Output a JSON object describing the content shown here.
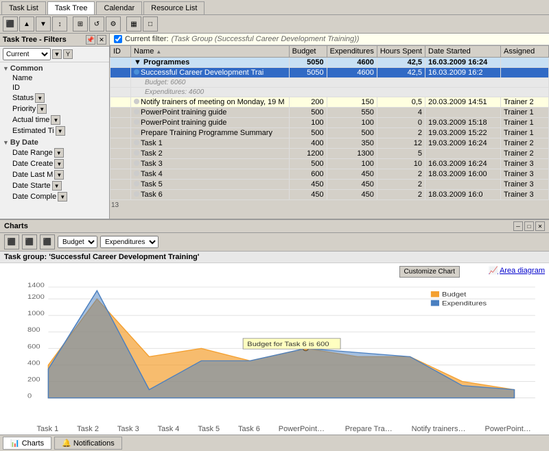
{
  "tabs": {
    "items": [
      "Task List",
      "Task Tree",
      "Calendar",
      "Resource List"
    ],
    "active": "Task Tree"
  },
  "toolbar": {
    "buttons": [
      "⬛",
      "↑",
      "↓",
      "↕",
      "⊞",
      "↺",
      "⚙",
      "▦",
      "□"
    ]
  },
  "left_panel": {
    "title": "Task Tree - Filters",
    "filter_label": "Current",
    "sections": {
      "common": {
        "label": "Common",
        "items": [
          "Name",
          "ID",
          "Status",
          "Priority",
          "Actual time",
          "Estimated Ti"
        ]
      },
      "by_date": {
        "label": "By Date",
        "items": [
          "Date Range",
          "Date Create",
          "Date Last M",
          "Date Starte",
          "Date Comple"
        ]
      }
    }
  },
  "filter_bar": {
    "checkbox_checked": true,
    "label": "Current filter:",
    "value": "(Task Group (Successful Career Development Training))"
  },
  "table": {
    "columns": [
      "ID",
      "Name",
      "Budget",
      "Expenditures",
      "Hours Spent",
      "Date Started",
      "Assigned"
    ],
    "rows": [
      {
        "id": "",
        "name": "Programmes",
        "budget": "5050",
        "expenditures": "4600",
        "hours": "42,5",
        "date": "16.03.2009 16:24",
        "assigned": "",
        "type": "group-top"
      },
      {
        "id": "",
        "name": "Successful Career Development Trai",
        "budget": "5050",
        "expenditures": "4600",
        "hours": "42,5",
        "date": "16.03.2009 16:2",
        "assigned": "",
        "type": "selected"
      },
      {
        "id": "",
        "name": "Budget: 6060",
        "budget": "",
        "expenditures": "",
        "hours": "",
        "date": "",
        "assigned": "",
        "type": "budget-row"
      },
      {
        "id": "",
        "name": "Expenditures: 4600",
        "budget": "",
        "expenditures": "",
        "hours": "",
        "date": "",
        "assigned": "",
        "type": "budget-row"
      },
      {
        "id": "",
        "name": "Notify trainers of meeting on Monday, 19 M",
        "budget": "200",
        "expenditures": "150",
        "hours": "0,5",
        "date": "20.03.2009 14:51",
        "assigned": "Trainer 2",
        "type": "notify"
      },
      {
        "id": "",
        "name": "PowerPoint training guide",
        "budget": "500",
        "expenditures": "550",
        "hours": "4",
        "date": "",
        "assigned": "Trainer 1",
        "type": "normal"
      },
      {
        "id": "",
        "name": "PowerPoint training guide",
        "budget": "100",
        "expenditures": "100",
        "hours": "0",
        "date": "19.03.2009 15:18",
        "assigned": "Trainer 1",
        "type": "normal"
      },
      {
        "id": "",
        "name": "Prepare Training Programme Summary",
        "budget": "500",
        "expenditures": "500",
        "hours": "2",
        "date": "19.03.2009 15:22",
        "assigned": "Trainer 1",
        "type": "normal"
      },
      {
        "id": "",
        "name": "Task 1",
        "budget": "400",
        "expenditures": "350",
        "hours": "12",
        "date": "19.03.2009 16:24",
        "assigned": "Trainer 2",
        "type": "normal"
      },
      {
        "id": "",
        "name": "Task 2",
        "budget": "1200",
        "expenditures": "1300",
        "hours": "5",
        "date": "",
        "assigned": "Trainer 2",
        "type": "normal"
      },
      {
        "id": "",
        "name": "Task 3",
        "budget": "500",
        "expenditures": "100",
        "hours": "10",
        "date": "16.03.2009 16:24",
        "assigned": "Trainer 3",
        "type": "normal"
      },
      {
        "id": "",
        "name": "Task 4",
        "budget": "600",
        "expenditures": "450",
        "hours": "2",
        "date": "18.03.2009 16:00",
        "assigned": "Trainer 3",
        "type": "normal"
      },
      {
        "id": "",
        "name": "Task 5",
        "budget": "450",
        "expenditures": "450",
        "hours": "2",
        "date": "",
        "assigned": "Trainer 3",
        "type": "normal"
      },
      {
        "id": "",
        "name": "Task 6",
        "budget": "450",
        "expenditures": "450",
        "hours": "2",
        "date": "18.03.2009 16:0",
        "assigned": "Trainer 3",
        "type": "normal"
      }
    ],
    "row_count": "13"
  },
  "charts": {
    "title": "Charts",
    "group_label": "Task group: 'Successful Career Development Training'",
    "series1": "Budget",
    "series2": "Expenditures",
    "customize_btn": "Customize Chart",
    "area_diagram_label": "Area diagram",
    "tooltip": "Budget for Task 6 is 600",
    "x_labels": [
      "Task 1",
      "Task 2",
      "Task 3",
      "Task 4",
      "Task 5",
      "Task 6",
      "PowerPoint training guide",
      "Prepare Training Programme...",
      "Notify trainers of meeting on...",
      "PowerPoint training guide"
    ],
    "budget_values": [
      400,
      1200,
      500,
      600,
      450,
      600,
      500,
      500,
      200,
      100
    ],
    "expenditures_values": [
      350,
      1300,
      100,
      450,
      450,
      600,
      550,
      500,
      150,
      100
    ],
    "y_axis": [
      0,
      200,
      400,
      600,
      800,
      1000,
      1200,
      1400
    ],
    "legend": {
      "budget_color": "#f4a030",
      "expenditures_color": "#4a7fc0"
    }
  },
  "bottom_tabs": {
    "items": [
      "Charts",
      "Notifications"
    ],
    "active": "Charts"
  }
}
